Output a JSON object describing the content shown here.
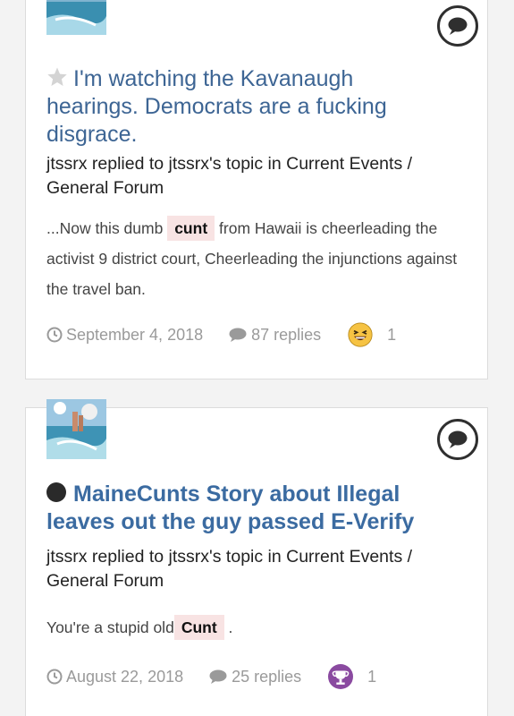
{
  "posts": [
    {
      "title": "I'm watching the Kavanaugh hearings. Democrats are a fucking disgrace.",
      "title_icon": "star-icon",
      "meta": "jtssrx replied to jtssrx's topic in Current Events / General Forum",
      "snippet_before": "...Now this dumb",
      "snippet_highlight": "cunt",
      "snippet_after": "from Hawaii is cheerleading the activist 9 district court, Cheerleading the injunctions against the travel ban.",
      "date": "September 4, 2018",
      "replies": "87 replies",
      "reaction_icon": "laughing-face-icon",
      "reaction_count": "1"
    },
    {
      "title": "MaineCunts Story about Illegal leaves out the guy passed E-Verify",
      "title_icon": "filled-dot-icon",
      "meta": "jtssrx replied to jtssrx's topic in Current Events / General Forum",
      "snippet_before": "You're a stupid old",
      "snippet_highlight": "Cunt",
      "snippet_after": ".",
      "date": "August 22, 2018",
      "replies": "25 replies",
      "reaction_icon": "trophy-icon",
      "reaction_count": "1"
    }
  ],
  "colors": {
    "title": "#3d6594",
    "highlight_bg": "#f8e3e3",
    "meta_text": "#9a9a9a",
    "trophy": "#8a4aa0",
    "laugh": "#f6c343"
  }
}
